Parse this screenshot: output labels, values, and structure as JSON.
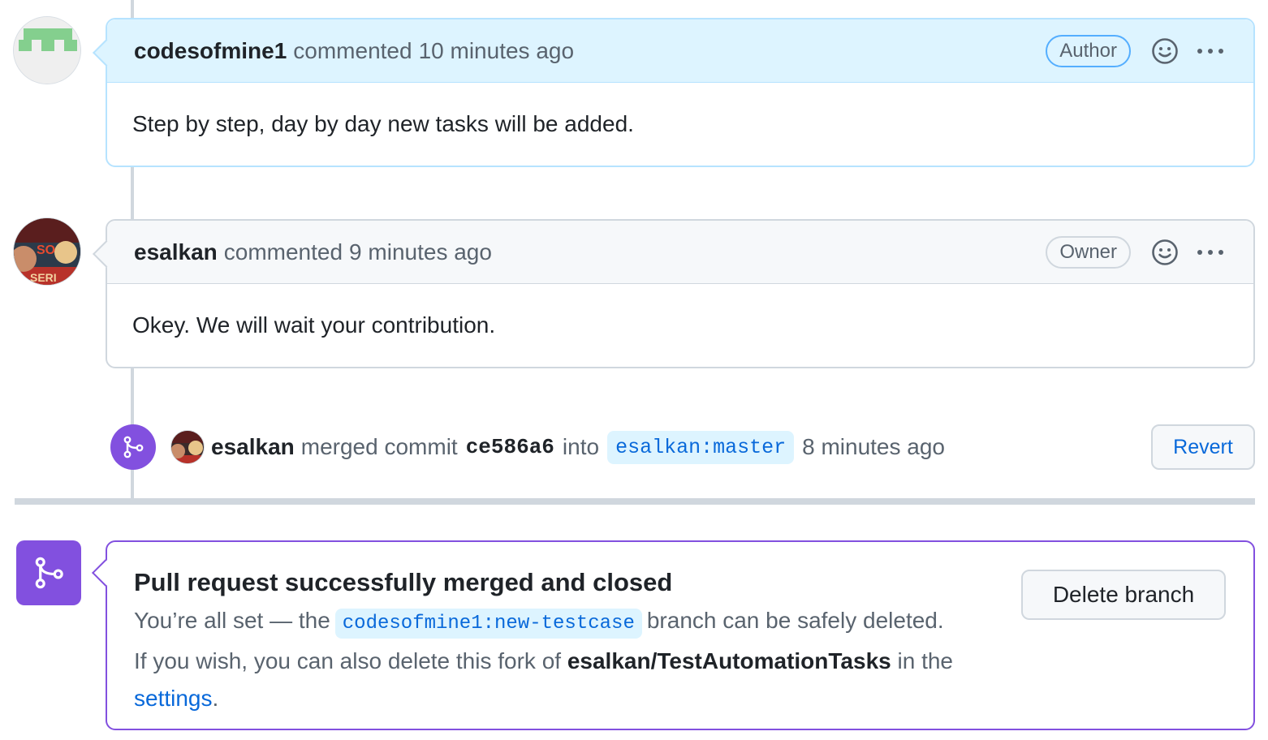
{
  "comments": [
    {
      "author": "codesofmine1",
      "action": "commented",
      "time": "10 minutes ago",
      "role": "Author",
      "body": "Step by step, day by day new tasks will be added."
    },
    {
      "author": "esalkan",
      "action": "commented",
      "time": "9 minutes ago",
      "role": "Owner",
      "body": "Okey. We will wait your contribution."
    }
  ],
  "merge_event": {
    "actor": "esalkan",
    "action": "merged commit",
    "commit_sha": "ce586a6",
    "into_label": "into",
    "target_branch": "esalkan:master",
    "time": "8 minutes ago",
    "revert_label": "Revert"
  },
  "merged_box": {
    "title": "Pull request successfully merged and closed",
    "line1_prefix": "You’re all set — the",
    "branch": "codesofmine1:new-testcase",
    "line1_suffix": "branch can be safely deleted.",
    "line2_prefix": "If you wish, you can also delete this fork of",
    "repo": "esalkan/TestAutomationTasks",
    "line2_mid": "in the",
    "settings_link": "settings",
    "line2_end": ".",
    "delete_button": "Delete branch"
  },
  "colors": {
    "author_header_bg": "#ddf4ff",
    "author_border": "#b6e3ff",
    "default_header_bg": "#f6f8fa",
    "default_border": "#d0d7de",
    "merged_purple": "#8250df",
    "link_blue": "#0969da"
  },
  "icons": {
    "reaction": "smiley-icon",
    "more": "kebab-horizontal-icon",
    "merge": "git-merge-icon"
  }
}
